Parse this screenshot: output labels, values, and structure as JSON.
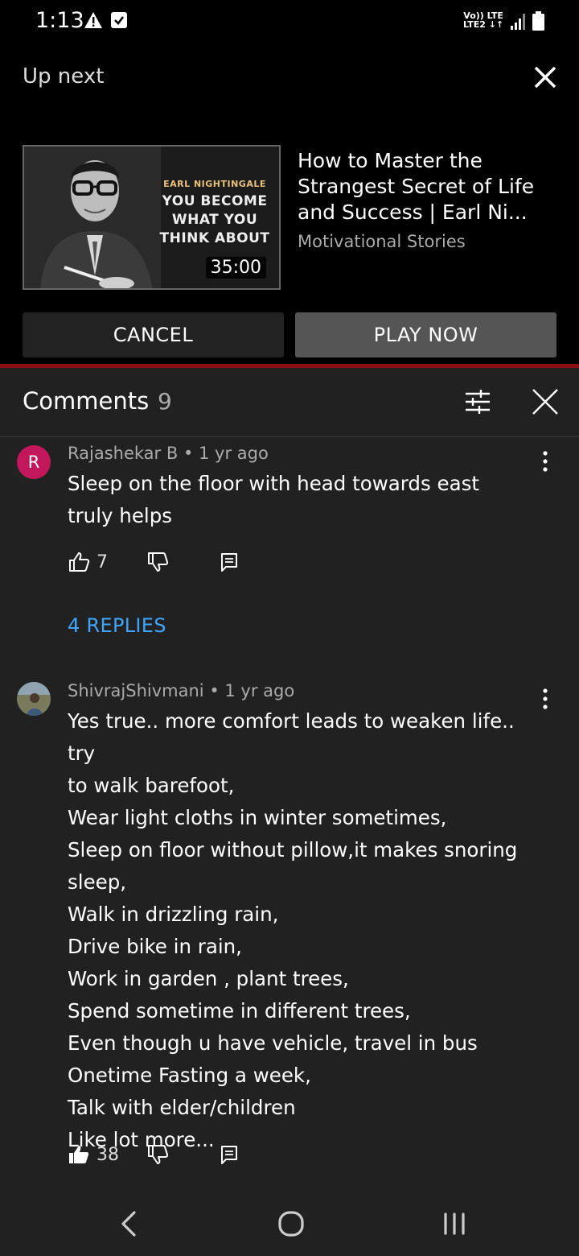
{
  "status_bar": {
    "time": "1:13",
    "network_line1": "Vo)) LTE",
    "network_line2": "LTE2 ↓↑"
  },
  "up_next": {
    "label": "Up next",
    "thumbnail": {
      "name": "EARL NIGHTINGALE",
      "line1": "YOU BECOME",
      "line2": "WHAT YOU",
      "line3": "THINK ABOUT",
      "duration": "35:00"
    },
    "title": "How to Master the Strangest Secret of Life and Success  | Earl Ni...",
    "channel": "Motivational Stories",
    "cancel_label": "CANCEL",
    "play_label": "PLAY NOW"
  },
  "comments": {
    "title": "Comments",
    "count": "9",
    "items": [
      {
        "avatar_letter": "R",
        "author": "Rajashekar B",
        "time": "1 yr ago",
        "text": "Sleep on the floor with head towards east truly helps",
        "likes": "7",
        "replies_label": "4 REPLIES",
        "avatar_color": "#c2185b"
      },
      {
        "author": "ShivrajShivmani",
        "time": "1 yr ago",
        "lines": [
          "Yes true.. more comfort leads to weaken life.. try",
          "to walk barefoot,",
          "Wear light cloths in winter sometimes,",
          "Sleep on floor without pillow,it makes snoring",
          "sleep,",
          "Walk in drizzling rain,",
          "Drive bike in rain,",
          "Work in garden , plant trees,",
          "Spend sometime in different trees,",
          "Even though u have vehicle, travel in bus",
          "Onetime Fasting a week,",
          "Talk with elder/children",
          "Like lot more..."
        ],
        "likes": "38"
      }
    ]
  },
  "colors": {
    "background": "#000000",
    "sheet": "#212121",
    "accent_link": "#3ea6ff",
    "progress_line": "#8a1010"
  }
}
